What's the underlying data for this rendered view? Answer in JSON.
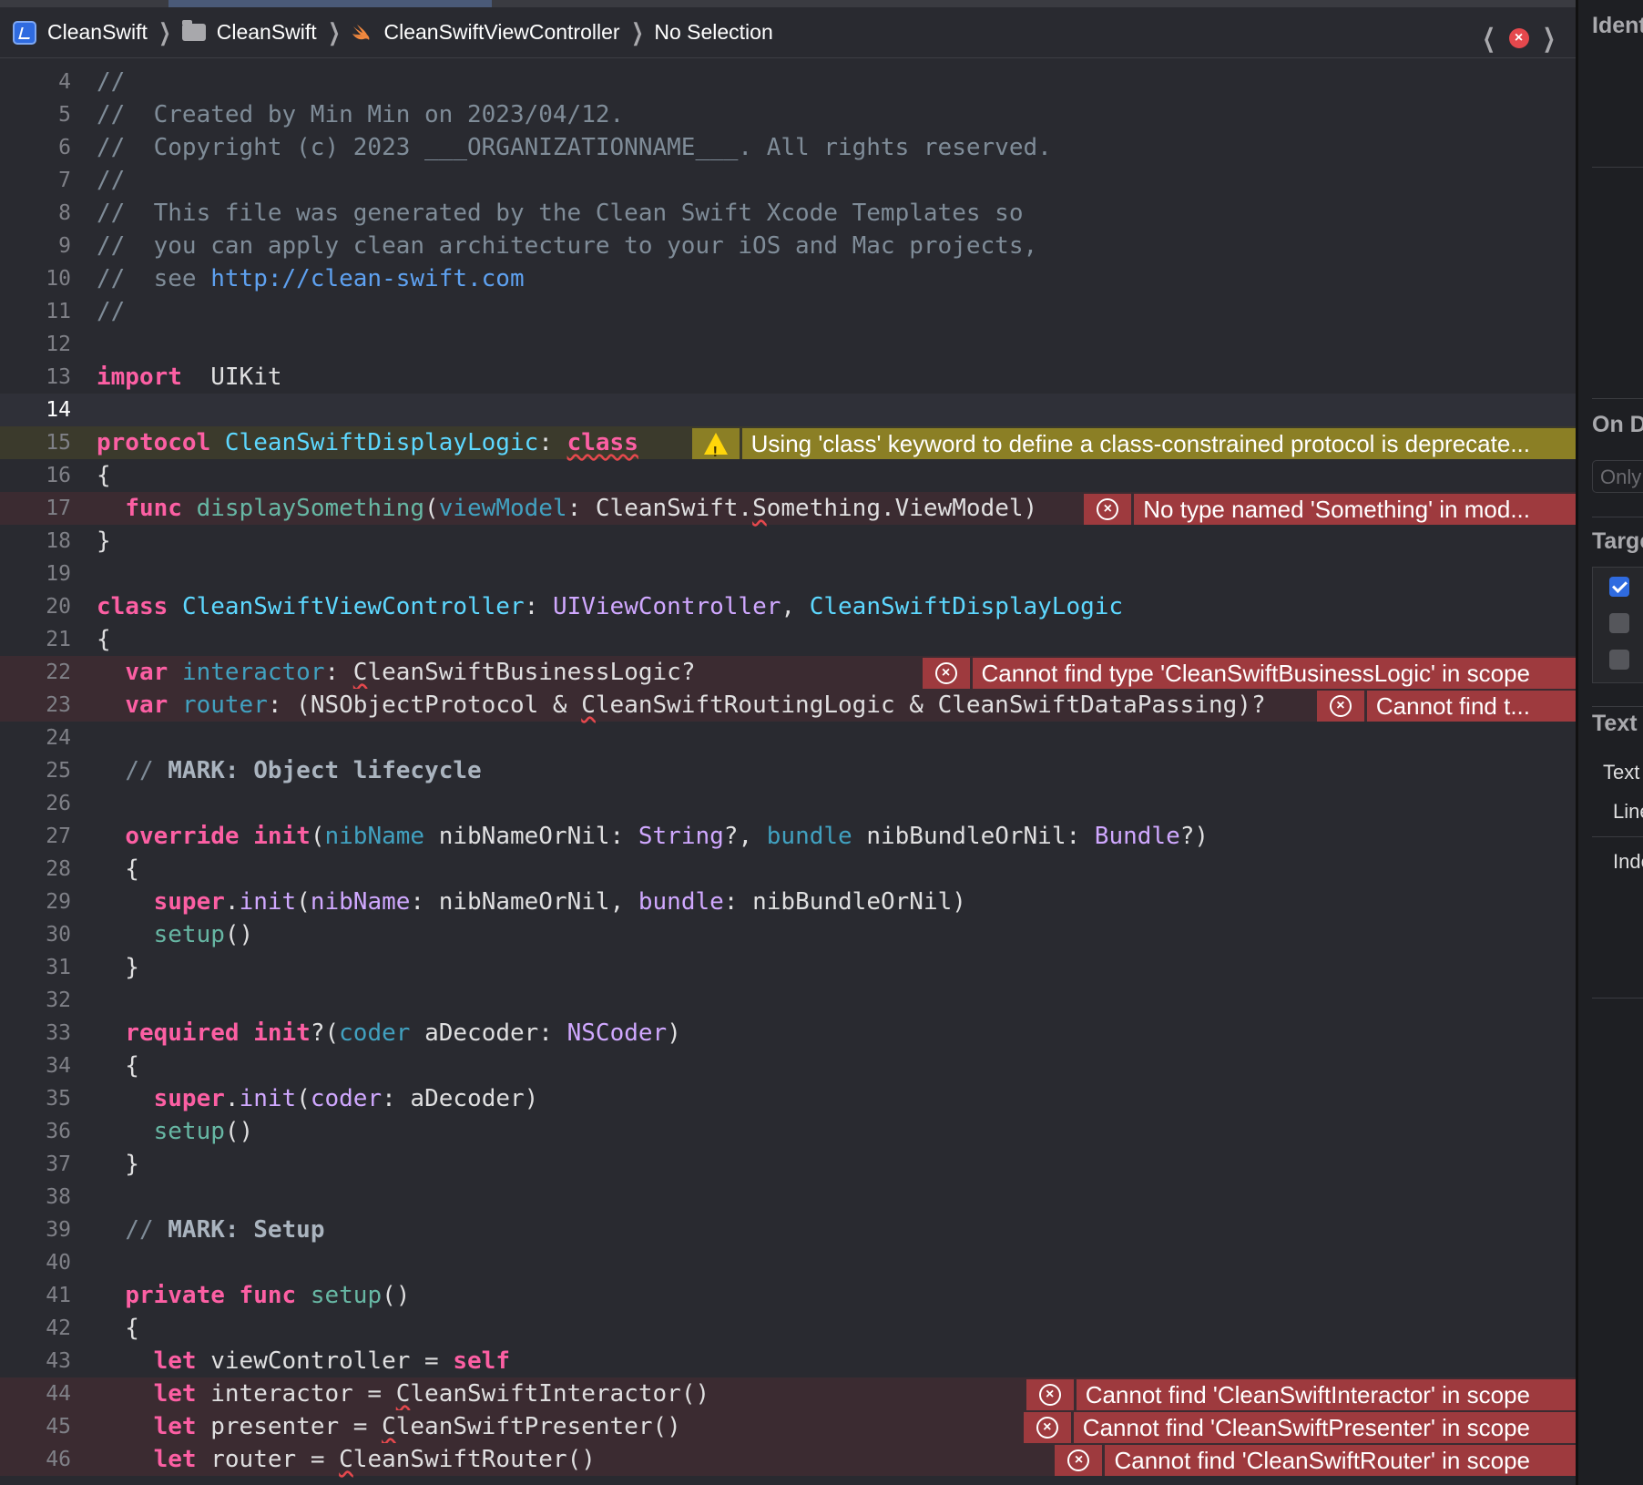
{
  "breadcrumb": {
    "project": "CleanSwift",
    "group": "CleanSwift",
    "file": "CleanSwiftViewController",
    "selection": "No Selection"
  },
  "lines": [
    {
      "n": "4",
      "parts": [
        [
          "cm",
          "//"
        ]
      ]
    },
    {
      "n": "5",
      "parts": [
        [
          "cm",
          "//  Created by Min Min on 2023/04/12."
        ]
      ]
    },
    {
      "n": "6",
      "parts": [
        [
          "cm",
          "//  Copyright (c) 2023 ___ORGANIZATIONNAME___. All rights reserved."
        ]
      ]
    },
    {
      "n": "7",
      "parts": [
        [
          "cm",
          "//"
        ]
      ]
    },
    {
      "n": "8",
      "parts": [
        [
          "cm",
          "//  This file was generated by the Clean Swift Xcode Templates so"
        ]
      ]
    },
    {
      "n": "9",
      "parts": [
        [
          "cm",
          "//  you can apply clean architecture to your iOS and Mac projects,"
        ]
      ]
    },
    {
      "n": "10",
      "parts": [
        [
          "cm",
          "//  see "
        ],
        [
          "url",
          "http://clean-swift.com"
        ]
      ]
    },
    {
      "n": "11",
      "parts": [
        [
          "cm",
          "//"
        ]
      ]
    },
    {
      "n": "12",
      "parts": []
    },
    {
      "n": "13",
      "parts": [
        [
          "kw",
          "import"
        ],
        [
          "",
          "  UIKit"
        ]
      ]
    },
    {
      "n": "14",
      "current": true,
      "parts": []
    },
    {
      "n": "15",
      "hl": "warn",
      "parts": [
        [
          "kw",
          "protocol"
        ],
        [
          "",
          " "
        ],
        [
          "ty",
          "CleanSwiftDisplayLogic"
        ],
        [
          "",
          ": "
        ],
        [
          "kw sq",
          "class"
        ]
      ],
      "diag": {
        "kind": "warn",
        "text": "Using 'class' keyword to define a class-constrained protocol is deprecate..."
      }
    },
    {
      "n": "16",
      "parts": [
        [
          "",
          "{"
        ]
      ]
    },
    {
      "n": "17",
      "hl": "err",
      "parts": [
        [
          "",
          "  "
        ],
        [
          "kw",
          "func"
        ],
        [
          "",
          " "
        ],
        [
          "fn",
          "displaySomething"
        ],
        [
          "",
          "("
        ],
        [
          "nm",
          "viewModel"
        ],
        [
          "",
          ": CleanSwift."
        ],
        [
          "sq",
          "S"
        ],
        [
          "",
          "omething.ViewModel)"
        ]
      ],
      "diag": {
        "kind": "err",
        "text": "No type named 'Something' in mod..."
      }
    },
    {
      "n": "18",
      "parts": [
        [
          "",
          "}"
        ]
      ]
    },
    {
      "n": "19",
      "parts": []
    },
    {
      "n": "20",
      "parts": [
        [
          "kw",
          "class"
        ],
        [
          "",
          " "
        ],
        [
          "ty",
          "CleanSwiftViewController"
        ],
        [
          "",
          ": "
        ],
        [
          "sys",
          "UIViewController"
        ],
        [
          "",
          ", "
        ],
        [
          "tyd",
          "CleanSwiftDisplayLogic"
        ]
      ]
    },
    {
      "n": "21",
      "parts": [
        [
          "",
          "{"
        ]
      ]
    },
    {
      "n": "22",
      "hl": "err",
      "parts": [
        [
          "",
          "  "
        ],
        [
          "kw",
          "var"
        ],
        [
          "",
          " "
        ],
        [
          "nm",
          "interactor"
        ],
        [
          "",
          ": "
        ],
        [
          "sq",
          "C"
        ],
        [
          "",
          "leanSwiftBusinessLogic?"
        ]
      ],
      "diag": {
        "kind": "err",
        "text": "Cannot find type 'CleanSwiftBusinessLogic' in scope"
      }
    },
    {
      "n": "23",
      "hl": "err",
      "parts": [
        [
          "",
          "  "
        ],
        [
          "kw",
          "var"
        ],
        [
          "",
          " "
        ],
        [
          "nm",
          "router"
        ],
        [
          "",
          ": (NSObjectProtocol & "
        ],
        [
          "sq",
          "C"
        ],
        [
          "",
          "leanSwiftRoutingLogic & CleanSwiftDataPassing)?"
        ]
      ],
      "diag": {
        "kind": "err",
        "text": "Cannot find t..."
      }
    },
    {
      "n": "24",
      "parts": []
    },
    {
      "n": "25",
      "parts": [
        [
          "",
          "  "
        ],
        [
          "cm",
          "// "
        ],
        [
          "cmb",
          "MARK: Object lifecycle"
        ]
      ]
    },
    {
      "n": "26",
      "parts": []
    },
    {
      "n": "27",
      "parts": [
        [
          "",
          "  "
        ],
        [
          "kw",
          "override"
        ],
        [
          "",
          " "
        ],
        [
          "kw",
          "init"
        ],
        [
          "",
          "("
        ],
        [
          "nm",
          "nibName"
        ],
        [
          "",
          " nibNameOrNil: "
        ],
        [
          "sys",
          "String"
        ],
        [
          "",
          "?, "
        ],
        [
          "nm",
          "bundle"
        ],
        [
          "",
          " nibBundleOrNil: "
        ],
        [
          "sys",
          "Bundle"
        ],
        [
          "",
          "?)"
        ]
      ]
    },
    {
      "n": "28",
      "parts": [
        [
          "",
          "  {"
        ]
      ]
    },
    {
      "n": "29",
      "parts": [
        [
          "",
          "    "
        ],
        [
          "kw",
          "super"
        ],
        [
          "",
          "."
        ],
        [
          "sys",
          "init"
        ],
        [
          "",
          "("
        ],
        [
          "sys",
          "nibName"
        ],
        [
          "",
          ": nibNameOrNil, "
        ],
        [
          "sys",
          "bundle"
        ],
        [
          "",
          ": nibBundleOrNil)"
        ]
      ]
    },
    {
      "n": "30",
      "parts": [
        [
          "",
          "    "
        ],
        [
          "fn",
          "setup"
        ],
        [
          "",
          "()"
        ]
      ]
    },
    {
      "n": "31",
      "parts": [
        [
          "",
          "  }"
        ]
      ]
    },
    {
      "n": "32",
      "parts": []
    },
    {
      "n": "33",
      "parts": [
        [
          "",
          "  "
        ],
        [
          "kw",
          "required"
        ],
        [
          "",
          " "
        ],
        [
          "kw",
          "init"
        ],
        [
          "",
          "?("
        ],
        [
          "nm",
          "coder"
        ],
        [
          "",
          " aDecoder: "
        ],
        [
          "sys",
          "NSCoder"
        ],
        [
          "",
          ")"
        ]
      ]
    },
    {
      "n": "34",
      "parts": [
        [
          "",
          "  {"
        ]
      ]
    },
    {
      "n": "35",
      "parts": [
        [
          "",
          "    "
        ],
        [
          "kw",
          "super"
        ],
        [
          "",
          "."
        ],
        [
          "sys",
          "init"
        ],
        [
          "",
          "("
        ],
        [
          "sys",
          "coder"
        ],
        [
          "",
          ": aDecoder)"
        ]
      ]
    },
    {
      "n": "36",
      "parts": [
        [
          "",
          "    "
        ],
        [
          "fn",
          "setup"
        ],
        [
          "",
          "()"
        ]
      ]
    },
    {
      "n": "37",
      "parts": [
        [
          "",
          "  }"
        ]
      ]
    },
    {
      "n": "38",
      "parts": []
    },
    {
      "n": "39",
      "parts": [
        [
          "",
          "  "
        ],
        [
          "cm",
          "// "
        ],
        [
          "cmb",
          "MARK: Setup"
        ]
      ]
    },
    {
      "n": "40",
      "parts": []
    },
    {
      "n": "41",
      "parts": [
        [
          "",
          "  "
        ],
        [
          "kw",
          "private"
        ],
        [
          "",
          " "
        ],
        [
          "kw",
          "func"
        ],
        [
          "",
          " "
        ],
        [
          "fn",
          "setup"
        ],
        [
          "",
          "()"
        ]
      ]
    },
    {
      "n": "42",
      "parts": [
        [
          "",
          "  {"
        ]
      ]
    },
    {
      "n": "43",
      "parts": [
        [
          "",
          "    "
        ],
        [
          "kw",
          "let"
        ],
        [
          "",
          " viewController = "
        ],
        [
          "kw",
          "self"
        ]
      ]
    },
    {
      "n": "44",
      "hl": "err",
      "parts": [
        [
          "",
          "    "
        ],
        [
          "kw",
          "let"
        ],
        [
          "",
          " interactor = "
        ],
        [
          "sq",
          "C"
        ],
        [
          "",
          "leanSwiftInteractor()"
        ]
      ],
      "diag": {
        "kind": "err",
        "text": "Cannot find 'CleanSwiftInteractor' in scope"
      }
    },
    {
      "n": "45",
      "hl": "err",
      "parts": [
        [
          "",
          "    "
        ],
        [
          "kw",
          "let"
        ],
        [
          "",
          " presenter = "
        ],
        [
          "sq",
          "C"
        ],
        [
          "",
          "leanSwiftPresenter()"
        ]
      ],
      "diag": {
        "kind": "err",
        "text": "Cannot find 'CleanSwiftPresenter' in scope"
      }
    },
    {
      "n": "46",
      "hl": "err",
      "parts": [
        [
          "",
          "    "
        ],
        [
          "kw",
          "let"
        ],
        [
          "",
          " router = "
        ],
        [
          "sq",
          "C"
        ],
        [
          "",
          "leanSwiftRouter()"
        ]
      ],
      "diag": {
        "kind": "err",
        "text": "Cannot find 'CleanSwiftRouter' in scope"
      }
    }
  ],
  "inspector": {
    "identity_header": "Ident",
    "on_demand_header": "On D",
    "on_demand_placeholder": "Only",
    "target_header": "Targe",
    "text_header": "Text",
    "text_encoding_label": "Text I",
    "line_endings_label": "Line",
    "indent_label": "Inde",
    "targets": [
      true,
      false,
      false
    ]
  }
}
